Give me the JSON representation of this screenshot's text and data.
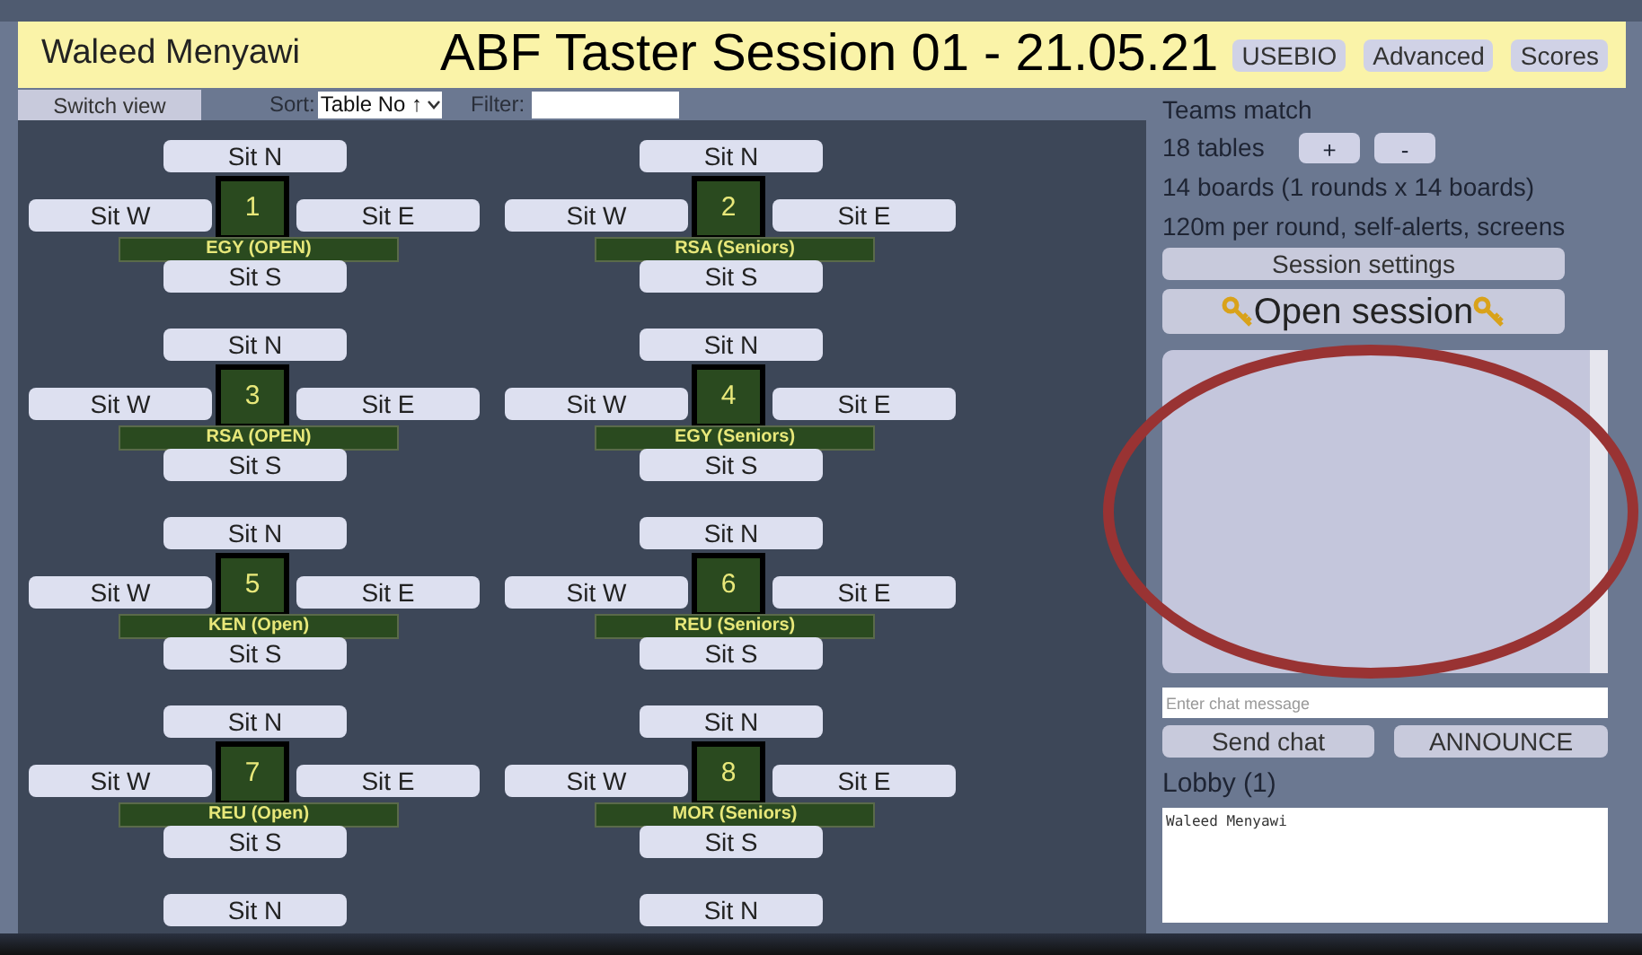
{
  "header": {
    "user": "Waleed Menyawi",
    "title": "ABF Taster Session 01 - 21.05.21",
    "buttons": [
      "USEBIO",
      "Advanced",
      "Scores"
    ]
  },
  "toolbar": {
    "switch_view": "Switch view",
    "sort_label": "Sort:",
    "sort_value": "Table No ↑",
    "filter_label": "Filter:"
  },
  "tables": [
    {
      "number": "1",
      "team": "EGY (OPEN)",
      "north": "Sit N",
      "west": "Sit W",
      "east": "Sit E",
      "south": "Sit S"
    },
    {
      "number": "2",
      "team": "RSA (Seniors)",
      "north": "Sit N",
      "west": "Sit W",
      "east": "Sit E",
      "south": "Sit S"
    },
    {
      "number": "3",
      "team": "RSA (OPEN)",
      "north": "Sit N",
      "west": "Sit W",
      "east": "Sit E",
      "south": "Sit S"
    },
    {
      "number": "4",
      "team": "EGY (Seniors)",
      "north": "Sit N",
      "west": "Sit W",
      "east": "Sit E",
      "south": "Sit S"
    },
    {
      "number": "5",
      "team": "KEN (Open)",
      "north": "Sit N",
      "west": "Sit W",
      "east": "Sit E",
      "south": "Sit S"
    },
    {
      "number": "6",
      "team": "REU (Seniors)",
      "north": "Sit N",
      "west": "Sit W",
      "east": "Sit E",
      "south": "Sit S"
    },
    {
      "number": "7",
      "team": "REU (Open)",
      "north": "Sit N",
      "west": "Sit W",
      "east": "Sit E",
      "south": "Sit S"
    },
    {
      "number": "8",
      "team": "MOR (Seniors)",
      "north": "Sit N",
      "west": "Sit W",
      "east": "Sit E",
      "south": "Sit S"
    },
    {
      "north": "Sit N"
    },
    {
      "north": "Sit N"
    }
  ],
  "session": {
    "type": "Teams match",
    "tables": "18 tables",
    "plus": "+",
    "minus": "-",
    "boards": "14 boards (1 rounds x 14 boards)",
    "timing": "120m per round, self-alerts, screens",
    "settings_button": "Session settings",
    "open_button": "Open session"
  },
  "chat": {
    "placeholder": "Enter chat message",
    "send": "Send chat",
    "announce": "ANNOUNCE"
  },
  "lobby": {
    "title": "Lobby (1)",
    "users": [
      "Waleed Menyawi"
    ]
  }
}
